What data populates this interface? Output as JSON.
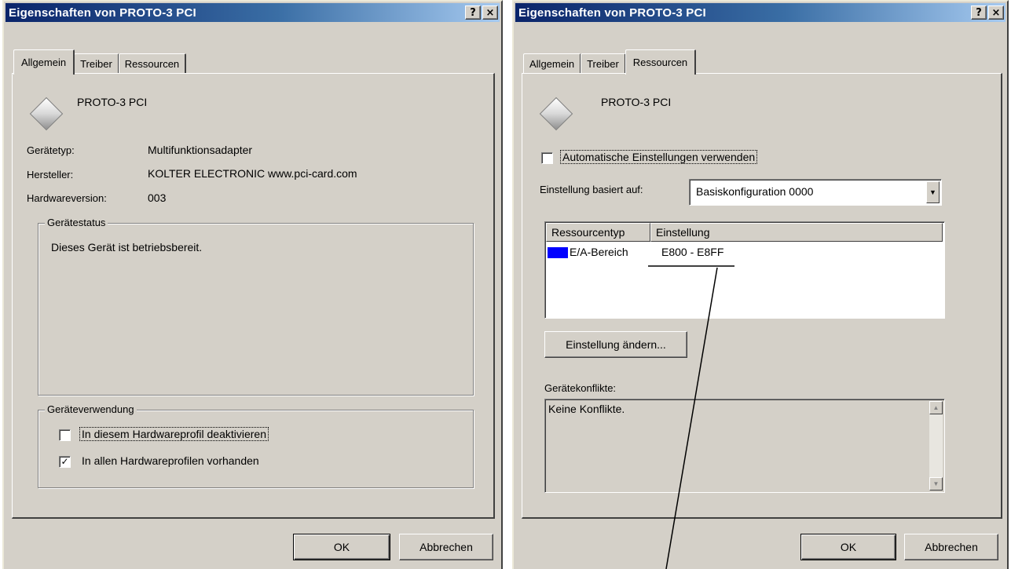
{
  "left_dialog": {
    "title": "Eigenschaften von PROTO-3 PCI",
    "help_label": "?",
    "close_label": "×",
    "tabs": [
      {
        "label": "Allgemein"
      },
      {
        "label": "Treiber"
      },
      {
        "label": "Ressourcen"
      }
    ],
    "active_tab": "Allgemein",
    "device_name": "PROTO-3 PCI",
    "properties": [
      {
        "label": "Gerätetyp:",
        "value": "Multifunktionsadapter"
      },
      {
        "label": "Hersteller:",
        "value": "KOLTER ELECTRONIC www.pci-card.com"
      },
      {
        "label": "Hardwareversion:",
        "value": "003"
      }
    ],
    "status_group": {
      "title": "Gerätestatus",
      "text": "Dieses Gerät ist betriebsbereit."
    },
    "usage_group": {
      "title": "Geräteverwendung",
      "options": [
        {
          "label": "In diesem Hardwareprofil deaktivieren",
          "checked": false,
          "mark": ""
        },
        {
          "label": "In allen Hardwareprofilen vorhanden",
          "checked": true,
          "mark": "✓"
        }
      ]
    },
    "buttons": {
      "ok": "OK",
      "cancel": "Abbrechen"
    }
  },
  "right_dialog": {
    "title": "Eigenschaften von PROTO-3 PCI",
    "help_label": "?",
    "close_label": "×",
    "tabs": [
      {
        "label": "Allgemein"
      },
      {
        "label": "Treiber"
      },
      {
        "label": "Ressourcen"
      }
    ],
    "active_tab": "Ressourcen",
    "device_name": "PROTO-3 PCI",
    "auto_settings": {
      "label": "Automatische Einstellungen verwenden",
      "checked": false
    },
    "based_on": {
      "label": "Einstellung basiert auf:",
      "value": "Basiskonfiguration 0000",
      "arrow": "▼"
    },
    "resources_table": {
      "columns": [
        "Ressourcentyp",
        "Einstellung"
      ],
      "rows": [
        {
          "type": "E/A-Bereich",
          "setting": "E800 - E8FF",
          "icon_color": "#0000ff"
        }
      ]
    },
    "change_button": "Einstellung ändern...",
    "conflicts": {
      "label": "Gerätekonflikte:",
      "text": "Keine Konflikte."
    },
    "scroll_up": "▲",
    "scroll_down": "▼",
    "buttons": {
      "ok": "OK",
      "cancel": "Abbrechen"
    }
  }
}
